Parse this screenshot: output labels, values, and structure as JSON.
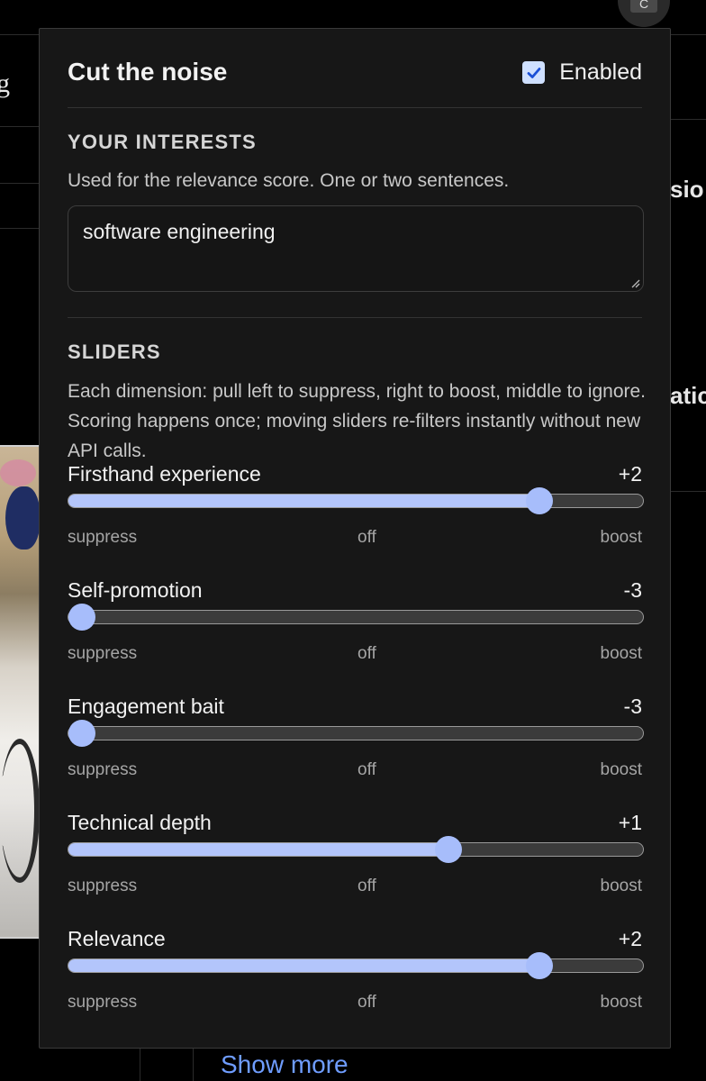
{
  "background": {
    "edge_left_text": "g",
    "edge_right_texts": [
      "sio",
      "atic"
    ],
    "avatar_initial": "C",
    "show_more": "Show more"
  },
  "popup": {
    "title": "Cut the noise",
    "enabled_label": "Enabled",
    "enabled": true,
    "interests": {
      "heading": "YOUR INTERESTS",
      "help": "Used for the relevance score. One or two sentences.",
      "value": "software engineering"
    },
    "sliders_section": {
      "heading": "SLIDERS",
      "help": "Each dimension: pull left to suppress, right to boost, middle to ignore. Scoring happens once; moving sliders re-filters instantly without new API calls."
    },
    "scale": {
      "min": -3,
      "max": 3
    },
    "sliders": [
      {
        "label": "Firsthand experience",
        "display": "+2",
        "value": 2,
        "ticks": [
          "suppress",
          "off",
          "boost"
        ]
      },
      {
        "label": "Self-promotion",
        "display": "-3",
        "value": -3,
        "ticks": [
          "suppress",
          "off",
          "boost"
        ]
      },
      {
        "label": "Engagement bait",
        "display": "-3",
        "value": -3,
        "ticks": [
          "suppress",
          "off",
          "boost"
        ]
      },
      {
        "label": "Technical depth",
        "display": "+1",
        "value": 1,
        "ticks": [
          "suppress",
          "off",
          "boost"
        ]
      },
      {
        "label": "Relevance",
        "display": "+2",
        "value": 2,
        "ticks": [
          "suppress",
          "off",
          "boost"
        ]
      }
    ],
    "colors": {
      "accent": "#a7bdfb",
      "fill": "#b3c5fb",
      "track": "#3b3b3b",
      "background": "#171717"
    }
  }
}
